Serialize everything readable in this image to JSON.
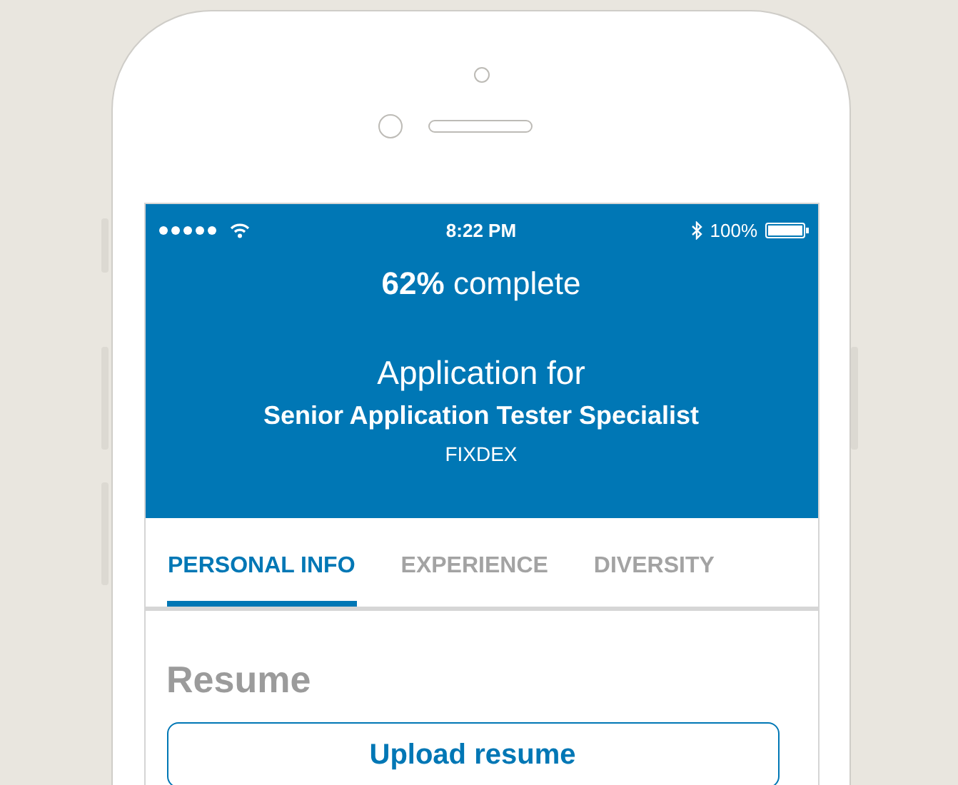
{
  "status_bar": {
    "time": "8:22 PM",
    "battery": "100%"
  },
  "header": {
    "progress": "**62%** complete",
    "heading": "Application for",
    "job_title": "Senior Application Tester Specialist",
    "company": "FIXDEX"
  },
  "tabs": [
    {
      "label": "PERSONAL INFO",
      "selected": true
    },
    {
      "label": "EXPERIENCE",
      "selected": false
    },
    {
      "label": "DIVERSITY",
      "selected": false
    }
  ],
  "section": {
    "title": "Resume",
    "button": "Upload resume"
  }
}
